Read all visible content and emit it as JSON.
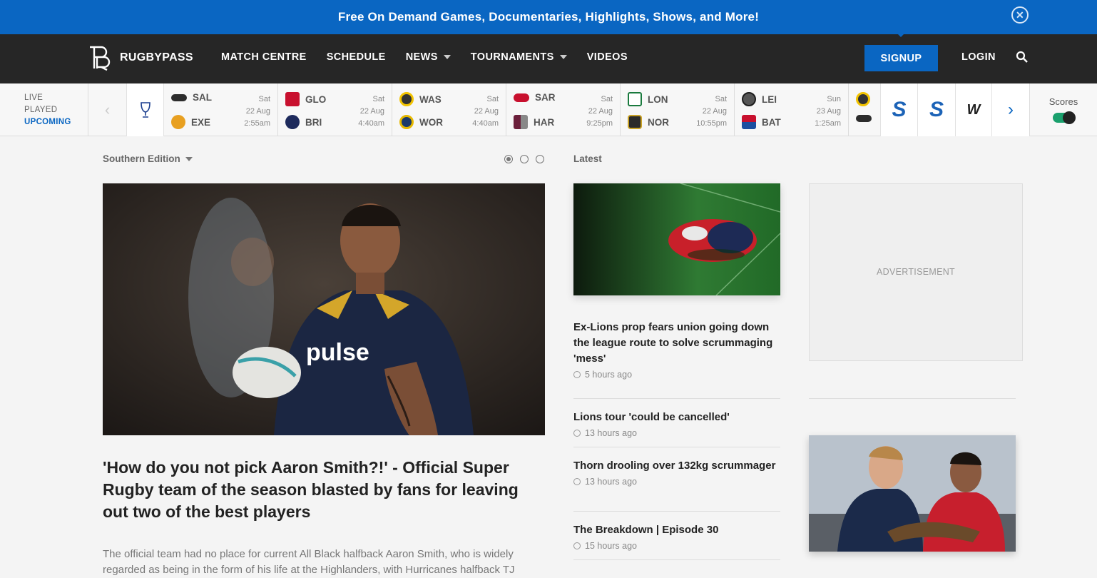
{
  "promo": {
    "text": "Free On Demand Games, Documentaries, Highlights, Shows, and More!"
  },
  "nav": {
    "logo_text": "RUGBYPASS",
    "items": [
      {
        "label": "MATCH CENTRE"
      },
      {
        "label": "SCHEDULE"
      },
      {
        "label": "NEWS"
      },
      {
        "label": "TOURNAMENTS"
      },
      {
        "label": "VIDEOS"
      }
    ],
    "signup": "SIGNUP",
    "login": "LOGIN"
  },
  "scores": {
    "status": [
      "LIVE",
      "PLAYED",
      "UPCOMING"
    ],
    "matches": [
      {
        "home": "SAL",
        "away": "EXE",
        "day": "Sat",
        "date": "22 Aug",
        "time": "2:55am"
      },
      {
        "home": "GLO",
        "away": "BRI",
        "day": "Sat",
        "date": "22 Aug",
        "time": "4:40am"
      },
      {
        "home": "WAS",
        "away": "WOR",
        "day": "Sat",
        "date": "22 Aug",
        "time": "4:40am"
      },
      {
        "home": "SAR",
        "away": "HAR",
        "day": "Sat",
        "date": "22 Aug",
        "time": "9:25pm"
      },
      {
        "home": "LON",
        "away": "NOR",
        "day": "Sat",
        "date": "22 Aug",
        "time": "10:55pm"
      },
      {
        "home": "LEI",
        "away": "BAT",
        "day": "Sun",
        "date": "23 Aug",
        "time": "1:25am"
      }
    ],
    "toggle_label": "Scores",
    "colors": {
      "accent": "#0a66c2",
      "toggle": "#1aa06d"
    }
  },
  "main": {
    "edition": "Southern Edition",
    "hero": {
      "title": "'How do you not pick Aaron Smith?!' - Official Super Rugby team of the season blasted by fans for leaving out two of the best players",
      "description": "The official team had no place for current All Black halfback Aaron Smith, who is widely regarded as being in the form of his life at the Highlanders, with Hurricanes halfback TJ"
    },
    "latest_label": "Latest",
    "articles": [
      {
        "title": "Ex-Lions prop fears union going down the league route to solve scrummaging 'mess'",
        "time": "5 hours ago"
      },
      {
        "title": "Lions tour 'could be cancelled'",
        "time": "13 hours ago"
      },
      {
        "title": "Thorn drooling over 132kg scrummager",
        "time": "13 hours ago"
      },
      {
        "title": "The Breakdown | Episode 30",
        "time": "15 hours ago"
      }
    ],
    "ad_label": "ADVERTISEMENT"
  }
}
